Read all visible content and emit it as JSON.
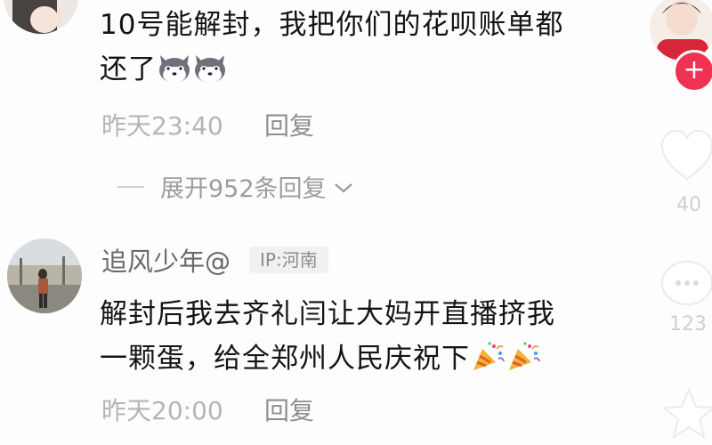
{
  "comments": [
    {
      "text_line1": "10号能解封，我把你们的花呗账单都",
      "text_line2": "还了",
      "emoji_icons": [
        "husky-face-icon",
        "husky-face-icon"
      ],
      "time": "昨天23:40",
      "reply_label": "回复",
      "expand_label": "展开952条回复"
    },
    {
      "username": "追风少年@",
      "ip_label": "IP:河南",
      "text_line1": "解封后我去齐礼闫让大妈开直播挤我",
      "text_line2": "一颗蛋，给全郑州人民庆祝下",
      "emoji_icons": [
        "party-popper-icon",
        "party-popper-icon"
      ],
      "time": "昨天20:00",
      "reply_label": "回复"
    }
  ],
  "sidebar": {
    "likes": "40",
    "comments": "123",
    "follow_symbol": "+"
  },
  "colors": {
    "follow": "#ef3252",
    "meta": "#b5b5b5",
    "text": "#141414"
  }
}
